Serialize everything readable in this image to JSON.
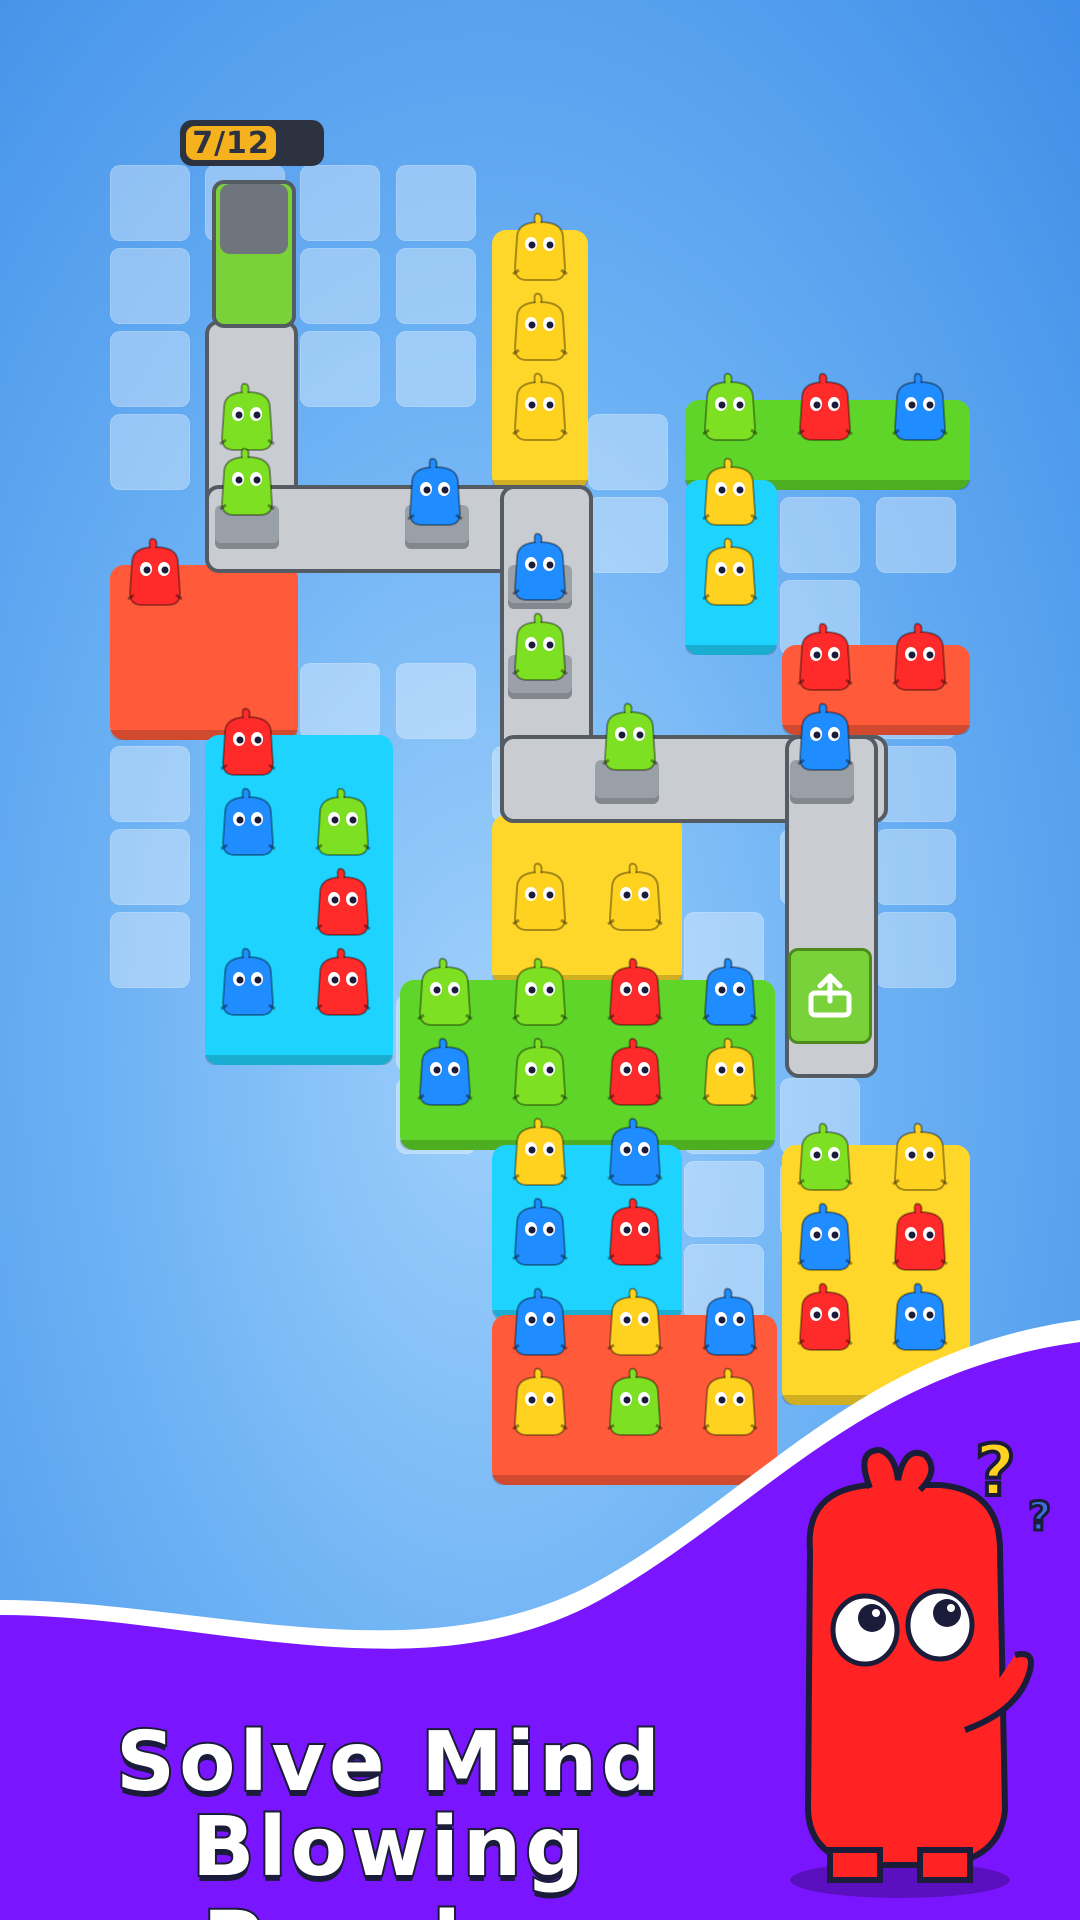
{
  "level_counter": {
    "text": "7/12"
  },
  "tagline": {
    "line1": "Solve Mind",
    "line2": "Blowing Puzzles"
  },
  "mascot": {
    "thought_icon": "question-mark-icon"
  },
  "exit_icon": "upload-arrow-icon",
  "colors": {
    "red": "#ff2a2a",
    "yellow": "#ffd21f",
    "green": "#7de022",
    "blue": "#1f8cff",
    "cyan": "#13d6ff",
    "purple_bg": "#7a16ff",
    "block_red": "#ff5a3a",
    "block_yellow": "#ffd62a",
    "block_green": "#5fd52a",
    "block_cyan": "#1ed4ff"
  }
}
